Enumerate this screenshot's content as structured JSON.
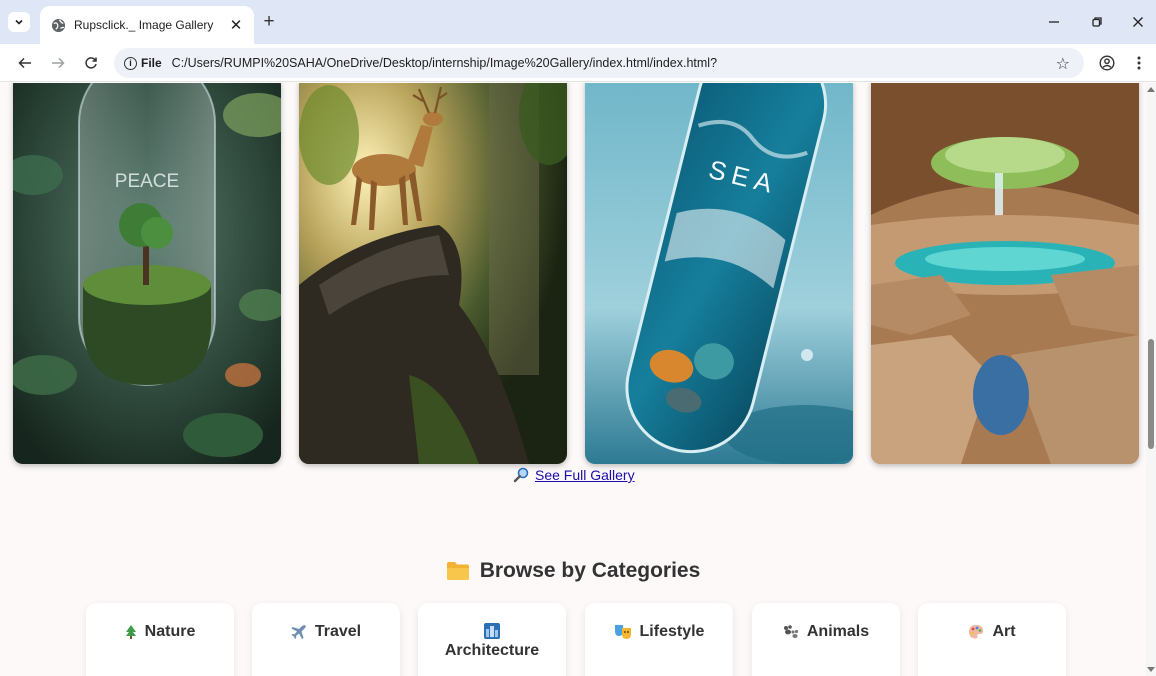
{
  "browser": {
    "tab_title": "Rupsclick._ Image Gallery",
    "new_tab_symbol": "+",
    "file_chip_label": "File",
    "url": "C:/Users/RUMPI%20SAHA/OneDrive/Desktop/internship/Image%20Gallery/index.html/index.html?"
  },
  "gallery": {
    "images": [
      {
        "name": "peace-capsule",
        "overlay_text": "PEACE"
      },
      {
        "name": "deer-on-rock",
        "overlay_text": ""
      },
      {
        "name": "sea-capsule",
        "overlay_text": "SEA"
      },
      {
        "name": "cave-waterfall",
        "overlay_text": ""
      }
    ],
    "see_full_label": "See Full Gallery"
  },
  "categories": {
    "heading": "Browse by Categories",
    "items": [
      {
        "label": "Nature",
        "icon": "tree-icon"
      },
      {
        "label": "Travel",
        "icon": "airplane-icon"
      },
      {
        "label": "Architecture",
        "icon": "city-icon"
      },
      {
        "label": "Lifestyle",
        "icon": "masks-icon"
      },
      {
        "label": "Animals",
        "icon": "paw-icon"
      },
      {
        "label": "Art",
        "icon": "palette-icon"
      }
    ]
  },
  "colors": {
    "page_bg": "#fcf9f8",
    "link": "#1a0dab",
    "heading": "#333333",
    "tabbar": "#dfe6f5"
  }
}
